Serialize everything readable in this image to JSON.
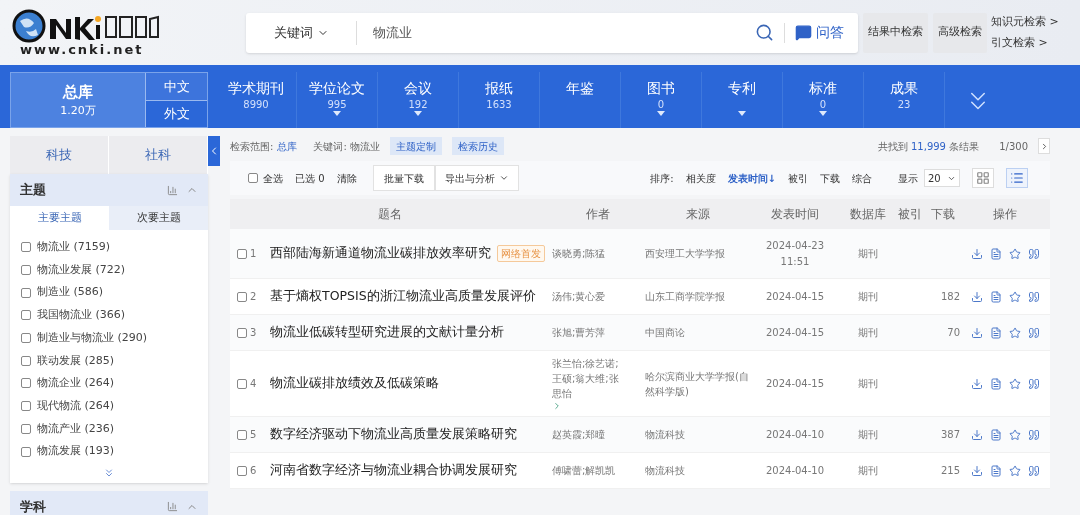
{
  "logo": {
    "site": "www.cnki.net"
  },
  "search": {
    "field": "关键词",
    "value": "物流业",
    "qa": "问答"
  },
  "header_buttons": [
    "结果中检索",
    "高级检索"
  ],
  "header_links": [
    "知识元检索 >",
    "引文检索 >"
  ],
  "library": {
    "title": "总库",
    "count": "1.20万",
    "langs": [
      {
        "label": "中文",
        "selected": true
      },
      {
        "label": "外文",
        "selected": false
      }
    ]
  },
  "categories": [
    {
      "label": "学术期刊",
      "count": "8990",
      "caret": false
    },
    {
      "label": "学位论文",
      "count": "995",
      "caret": true
    },
    {
      "label": "会议",
      "count": "192",
      "caret": true
    },
    {
      "label": "报纸",
      "count": "1633",
      "caret": false
    },
    {
      "label": "年鉴",
      "caret": false
    },
    {
      "label": "图书",
      "count": "0",
      "caret": true
    },
    {
      "label": "专利",
      "caret": true
    },
    {
      "label": "标准",
      "count": "0",
      "caret": true
    },
    {
      "label": "成果",
      "count": "23",
      "caret": false
    }
  ],
  "sidebar": {
    "tabs": [
      "科技",
      "社科"
    ],
    "panel": {
      "title": "主题",
      "subtabs": [
        {
          "label": "主要主题",
          "selected": true
        },
        {
          "label": "次要主题",
          "selected": false
        }
      ],
      "items": [
        {
          "label": "物流业 (7159)",
          "checked": false
        },
        {
          "label": "物流业发展 (722)",
          "checked": false
        },
        {
          "label": "制造业 (586)",
          "checked": false
        },
        {
          "label": "我国物流业 (366)",
          "checked": false
        },
        {
          "label": "制造业与物流业 (290)",
          "checked": false
        },
        {
          "label": "联动发展 (285)",
          "checked": false
        },
        {
          "label": "物流企业 (264)",
          "checked": false
        },
        {
          "label": "现代物流 (264)",
          "checked": false
        },
        {
          "label": "物流产业 (236)",
          "checked": false
        },
        {
          "label": "物流发展 (193)",
          "checked": false
        }
      ]
    },
    "next_panel": "学科"
  },
  "scope": {
    "label": "检索范围:",
    "value": "总库",
    "keyword": "关键词: 物流业",
    "buttons": [
      "主题定制",
      "检索历史"
    ]
  },
  "summary": {
    "prefix": "共找到",
    "count": "11,999",
    "suffix": "条结果",
    "page": "1/300"
  },
  "toolbar": {
    "select_all": "全选",
    "select_all_checked": false,
    "selected": "已选 0",
    "clear": "清除",
    "buttons": [
      "批量下载",
      "导出与分析"
    ]
  },
  "sort": {
    "label": "排序:",
    "options": [
      {
        "label": "相关度",
        "selected": false
      },
      {
        "label": "发表时间↓",
        "selected": true
      },
      {
        "label": "被引",
        "selected": false
      },
      {
        "label": "下载",
        "selected": false
      },
      {
        "label": "综合",
        "selected": false
      }
    ],
    "show_label": "显示",
    "show_value": "20",
    "views": [
      {
        "kind": "grid",
        "selected": false
      },
      {
        "kind": "list",
        "selected": true
      }
    ]
  },
  "table": {
    "columns": [
      "题名",
      "作者",
      "来源",
      "发表时间",
      "数据库",
      "被引",
      "下载",
      "操作"
    ],
    "rows": [
      {
        "index": "1",
        "title": "西部陆海新通道物流业碳排放效率研究",
        "badge": "网络首发",
        "authors": "谈晓勇;陈猛",
        "more": false,
        "checked": false,
        "source": "西安理工大学学报",
        "date": "2024-04-23 11:51",
        "db": "期刊"
      },
      {
        "index": "2",
        "title": "基于熵权TOPSIS的浙江物流业高质量发展评价",
        "authors": "汤伟;黄心爱",
        "more": false,
        "checked": false,
        "source": "山东工商学院学报",
        "date": "2024-04-15",
        "db": "期刊",
        "downloads": "182"
      },
      {
        "index": "3",
        "title": "物流业低碳转型研究进展的文献计量分析",
        "authors": "张旭;曹芳萍",
        "more": false,
        "checked": false,
        "source": "中国商论",
        "date": "2024-04-15",
        "db": "期刊",
        "downloads": "70"
      },
      {
        "index": "4",
        "title": "物流业碳排放绩效及低碳策略",
        "authors": "张兰怡;徐艺诺;王硕;翁大维;张思怡",
        "more": true,
        "checked": false,
        "source": "哈尔滨商业大学学报(自然科学版)",
        "date": "2024-04-15",
        "db": "期刊"
      },
      {
        "index": "5",
        "title": "数字经济驱动下物流业高质量发展策略研究",
        "authors": "赵英霞;郑曈",
        "more": false,
        "checked": false,
        "source": "物流科技",
        "date": "2024-04-10",
        "db": "期刊",
        "downloads": "387"
      },
      {
        "index": "6",
        "title": "河南省数字经济与物流业耦合协调发展研究",
        "authors": "傅啸蕾;解凯凯",
        "more": false,
        "checked": false,
        "source": "物流科技",
        "date": "2024-04-10",
        "db": "期刊",
        "downloads": "215"
      }
    ]
  }
}
